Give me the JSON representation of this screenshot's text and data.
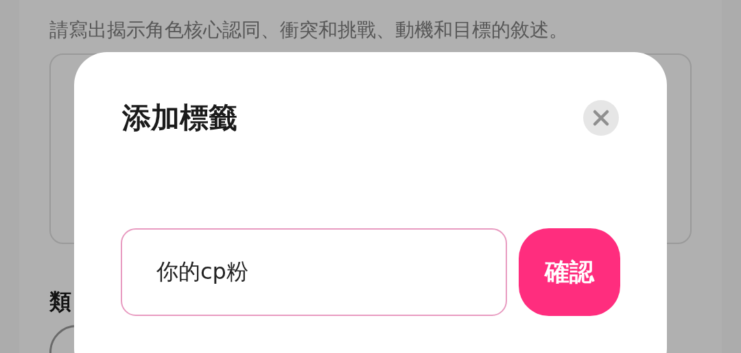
{
  "background": {
    "description_hint": "請寫出揭示角色核心認同、衝突和挑戰、動機和目標的敘述。",
    "section_heading": "類"
  },
  "dialog": {
    "title": "添加標籤",
    "input": {
      "value": "你的cp粉"
    },
    "confirm_button": "確認"
  }
}
